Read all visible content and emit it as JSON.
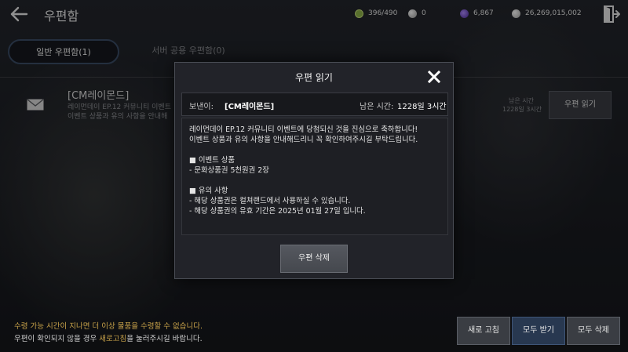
{
  "header": {
    "title": "우편함",
    "resources": [
      {
        "icon": "stamina-icon",
        "value": "396/490",
        "color": "#8fb34a"
      },
      {
        "icon": "white-orb-icon",
        "value": "0",
        "color": "#d8d8d8"
      },
      {
        "icon": "purple-gem-icon",
        "value": "6,867",
        "color": "#7a4fd0"
      },
      {
        "icon": "silver-coin-icon",
        "value": "26,269,015,002",
        "color": "#e4e4e4"
      }
    ]
  },
  "tabs": {
    "general": "일반 우편함(1)",
    "server": "서버 공용 우편함(0)"
  },
  "mail_list": [
    {
      "sender": "[CM레이몬드]",
      "preview_line1": "레이먼데이 EP.12 커뮤니티 이벤트",
      "preview_line2": "이벤트 상품과 유의 사항을 안내해",
      "remain_label": "남은 시간",
      "remain_value": "1228일 3시간",
      "read_button": "우편 읽기"
    }
  ],
  "modal": {
    "title": "우편 읽기",
    "sender_label": "보낸이:",
    "sender_value": "[CM레이몬드]",
    "remain_label": "남은 시간:",
    "remain_value": "1228일 3시간",
    "body_lines": [
      "레이먼데이 EP.12 커뮤니티 이벤트에 당첨되신 것을 진심으로 축하합니다!",
      "이벤트 상품과 유의 사항을 안내해드리니 꼭 확인하여주시길 부탁드립니다.",
      "",
      "■ 이벤트 상품",
      "- 문화상품권 5천원권 2장",
      "",
      "■ 유의 사항",
      "- 해당 상품권은 컬쳐랜드에서 사용하실 수 있습니다.",
      "- 해당 상품권의 유효 기간은 2025년 01월 27일 입니다."
    ],
    "delete_button": "우편 삭제"
  },
  "footer": {
    "notice_line1": "수령 가능 시간이 지나면 더 이상 물품을 수령할 수 없습니다.",
    "notice_line2_pre": "우편이 확인되지 않을 경우 ",
    "notice_line2_highlight": "새로고침",
    "notice_line2_post": "을 눌러주시길 바랍니다.",
    "refresh_button": "새로 고침",
    "receive_all_button": "모두 받기",
    "delete_all_button": "모두 삭제"
  }
}
